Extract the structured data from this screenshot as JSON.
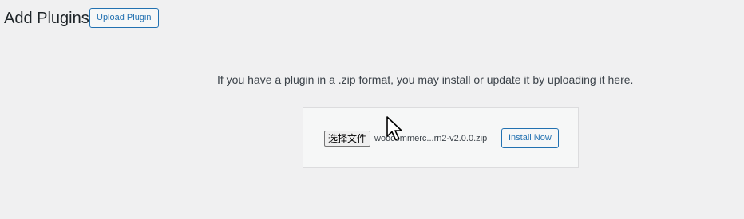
{
  "header": {
    "title": "Add Plugins",
    "upload_label": "Upload Plugin"
  },
  "upload": {
    "help_text": "If you have a plugin in a .zip format, you may install or update it by uploading it here.",
    "choose_file_label": "选择文件",
    "file_name": "woocommerc...rn2-v2.0.0.zip",
    "install_label": "Install Now"
  },
  "colors": {
    "accent": "#2271b1",
    "background": "#f0f0f1",
    "panel": "#f6f7f7",
    "text": "#3c434a"
  },
  "icons": {
    "cursor": "mouse-pointer-icon"
  }
}
